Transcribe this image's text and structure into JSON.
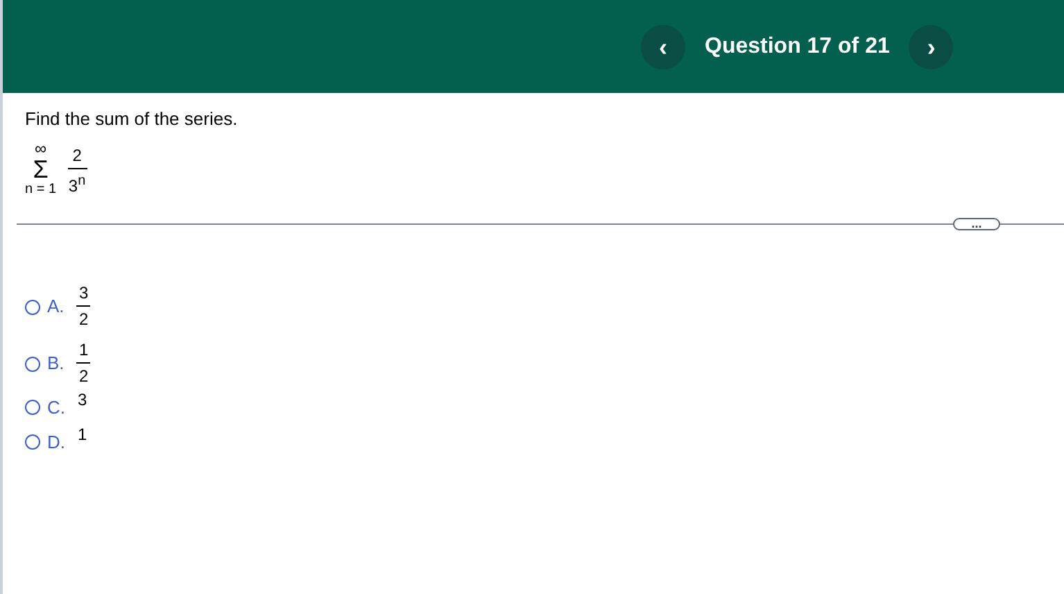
{
  "header": {
    "title": "Question 17 of 21",
    "prev_button": "‹",
    "next_button": "›"
  },
  "question": {
    "prompt": "Find the sum of the series.",
    "series": {
      "upper": "∞",
      "symbol": "Σ",
      "lower": "n = 1",
      "numerator": "2",
      "denominator": "3$^{n}$"
    }
  },
  "divider_button": "...",
  "options": [
    {
      "letter": "A.",
      "kind": "fraction",
      "numerator": "3",
      "denominator": "2",
      "selected": false
    },
    {
      "letter": "B.",
      "kind": "fraction",
      "numerator": "1",
      "denominator": "2",
      "selected": false
    },
    {
      "letter": "C.",
      "kind": "number",
      "value": "3",
      "selected": false
    },
    {
      "letter": "D.",
      "kind": "number",
      "value": "1",
      "selected": false
    }
  ]
}
